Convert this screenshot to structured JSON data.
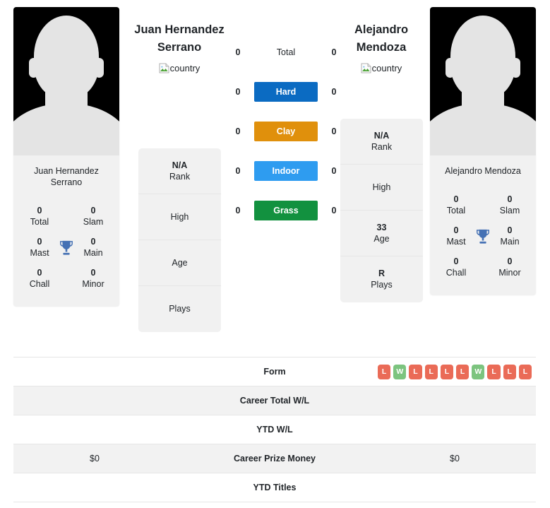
{
  "players": {
    "left": {
      "name": "Juan Hernandez Serrano",
      "name_line1": "Juan Hernandez",
      "name_line2": "Serrano",
      "card_name_line1": "Juan Hernandez",
      "card_name_line2": "Serrano",
      "country_alt": "country",
      "titles": {
        "total_value": "0",
        "total_label": "Total",
        "slam_value": "0",
        "slam_label": "Slam",
        "mast_value": "0",
        "mast_label": "Mast",
        "main_value": "0",
        "main_label": "Main",
        "chall_value": "0",
        "chall_label": "Chall",
        "minor_value": "0",
        "minor_label": "Minor"
      },
      "rank_panel": [
        {
          "value": "N/A",
          "label": "Rank"
        },
        {
          "value": "",
          "label": "High"
        },
        {
          "value": "",
          "label": "Age"
        },
        {
          "value": "",
          "label": "Plays"
        }
      ],
      "surface_wins": {
        "total": "0",
        "hard": "0",
        "clay": "0",
        "indoor": "0",
        "grass": "0"
      },
      "career_prize_money": "$0",
      "career_total_wl": "",
      "ytd_wl": "",
      "ytd_titles": "",
      "form": []
    },
    "right": {
      "name": "Alejandro Mendoza",
      "name_line1": "Alejandro",
      "name_line2": "Mendoza",
      "card_name_line1": "Alejandro Mendoza",
      "card_name_line2": "",
      "country_alt": "country",
      "titles": {
        "total_value": "0",
        "total_label": "Total",
        "slam_value": "0",
        "slam_label": "Slam",
        "mast_value": "0",
        "mast_label": "Mast",
        "main_value": "0",
        "main_label": "Main",
        "chall_value": "0",
        "chall_label": "Chall",
        "minor_value": "0",
        "minor_label": "Minor"
      },
      "rank_panel": [
        {
          "value": "N/A",
          "label": "Rank"
        },
        {
          "value": "",
          "label": "High"
        },
        {
          "value": "33",
          "label": "Age"
        },
        {
          "value": "R",
          "label": "Plays"
        }
      ],
      "surface_wins": {
        "total": "0",
        "hard": "0",
        "clay": "0",
        "indoor": "0",
        "grass": "0"
      },
      "career_prize_money": "$0",
      "career_total_wl": "",
      "ytd_wl": "",
      "ytd_titles": "",
      "form": [
        "L",
        "W",
        "L",
        "L",
        "L",
        "L",
        "W",
        "L",
        "L",
        "L"
      ]
    }
  },
  "surfaces": [
    {
      "key": "total",
      "label": "Total",
      "color": "transparent",
      "text_color": "#212529"
    },
    {
      "key": "hard",
      "label": "Hard",
      "color": "#0b6bc2",
      "text_color": "#ffffff"
    },
    {
      "key": "clay",
      "label": "Clay",
      "color": "#e0900c",
      "text_color": "#ffffff"
    },
    {
      "key": "indoor",
      "label": "Indoor",
      "color": "#2e9cf0",
      "text_color": "#ffffff"
    },
    {
      "key": "grass",
      "label": "Grass",
      "color": "#12913f",
      "text_color": "#ffffff"
    }
  ],
  "table": {
    "rows": [
      {
        "label": "Form",
        "left": "",
        "right": "form_badges"
      },
      {
        "label": "Career Total W/L",
        "left": "",
        "right": ""
      },
      {
        "label": "YTD W/L",
        "left": "",
        "right": ""
      },
      {
        "label": "Career Prize Money",
        "left": "$0",
        "right": "$0"
      },
      {
        "label": "YTD Titles",
        "left": "",
        "right": ""
      }
    ]
  },
  "colors": {
    "badge_win": "#7cc47f",
    "badge_loss": "#ea6b57",
    "panel_bg": "#f1f1f1",
    "row_shade": "#f2f2f2",
    "trophy": "#4571b4"
  },
  "icons": {
    "trophy": "trophy-icon",
    "broken_image": "broken-image-icon",
    "avatar": "player-avatar-placeholder"
  }
}
